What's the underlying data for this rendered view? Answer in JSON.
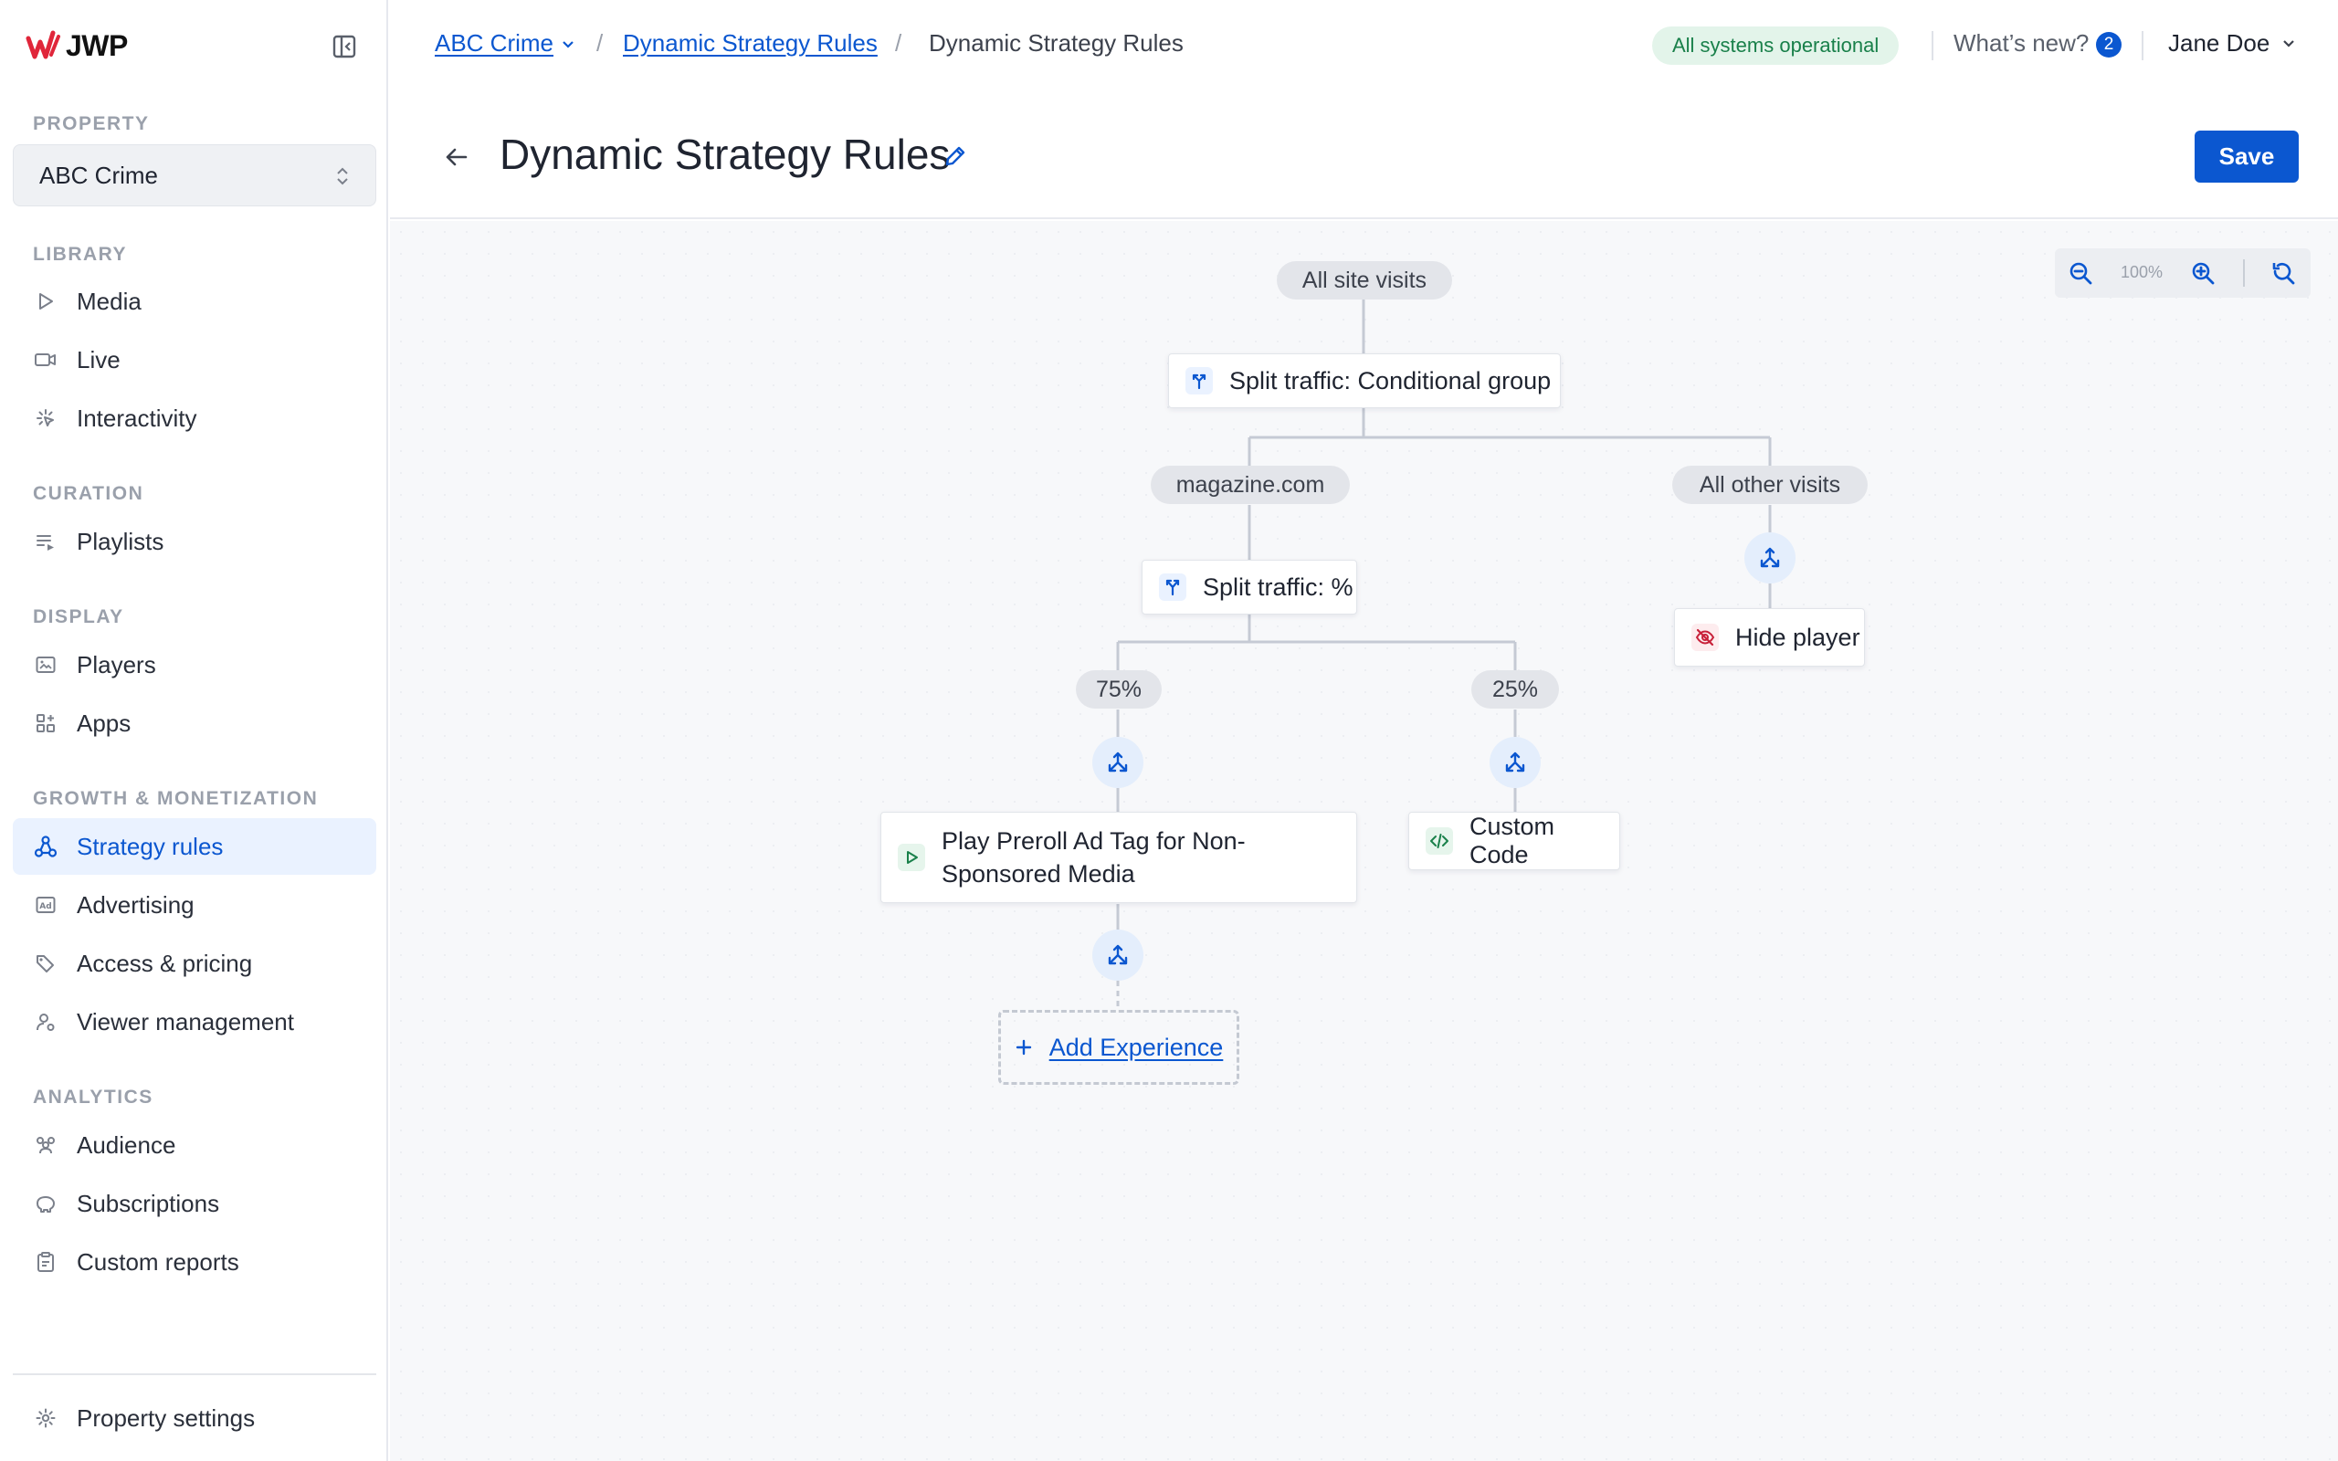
{
  "app": {
    "logo_text": "JWP"
  },
  "sidebar": {
    "property_label": "PROPERTY",
    "property_value": "ABC Crime",
    "sections": {
      "library": "LIBRARY",
      "curation": "CURATION",
      "display": "DISPLAY",
      "growth": "GROWTH & MONETIZATION",
      "analytics": "ANALYTICS"
    },
    "items": {
      "media": "Media",
      "live": "Live",
      "interactivity": "Interactivity",
      "playlists": "Playlists",
      "players": "Players",
      "apps": "Apps",
      "strategy_rules": "Strategy rules",
      "advertising": "Advertising",
      "access_pricing": "Access & pricing",
      "viewer_management": "Viewer management",
      "audience": "Audience",
      "subscriptions": "Subscriptions",
      "custom_reports": "Custom reports",
      "property_settings": "Property settings"
    },
    "active_item": "Strategy rules"
  },
  "topbar": {
    "breadcrumb": {
      "property": "ABC Crime",
      "section": "Dynamic Strategy Rules",
      "current": "Dynamic Strategy Rules",
      "separator": "/"
    },
    "status": "All systems operational",
    "whats_new": "What’s new?",
    "whats_new_count": "2",
    "user_name": "Jane Doe"
  },
  "page": {
    "title": "Dynamic Strategy Rules",
    "save_label": "Save"
  },
  "canvas": {
    "zoom_level": "100%",
    "root_pill": "All site visits",
    "split_conditional": "Split traffic: Conditional group",
    "branch_magazine": "magazine.com",
    "branch_other": "All other visits",
    "split_percent": "Split traffic: %",
    "branch_75": "75%",
    "branch_25": "25%",
    "hide_player": "Hide player",
    "preroll_line1": "Play Preroll Ad Tag for Non-",
    "preroll_line2": "Sponsored Media",
    "custom_code": "Custom Code",
    "add_experience": "Add Experience"
  },
  "colors": {
    "accent": "#0b57d0",
    "status_bg": "#e3f4ea",
    "status_text": "#19804a",
    "active_nav_bg": "#eaf2ff",
    "logo_red": "#e0263a"
  }
}
